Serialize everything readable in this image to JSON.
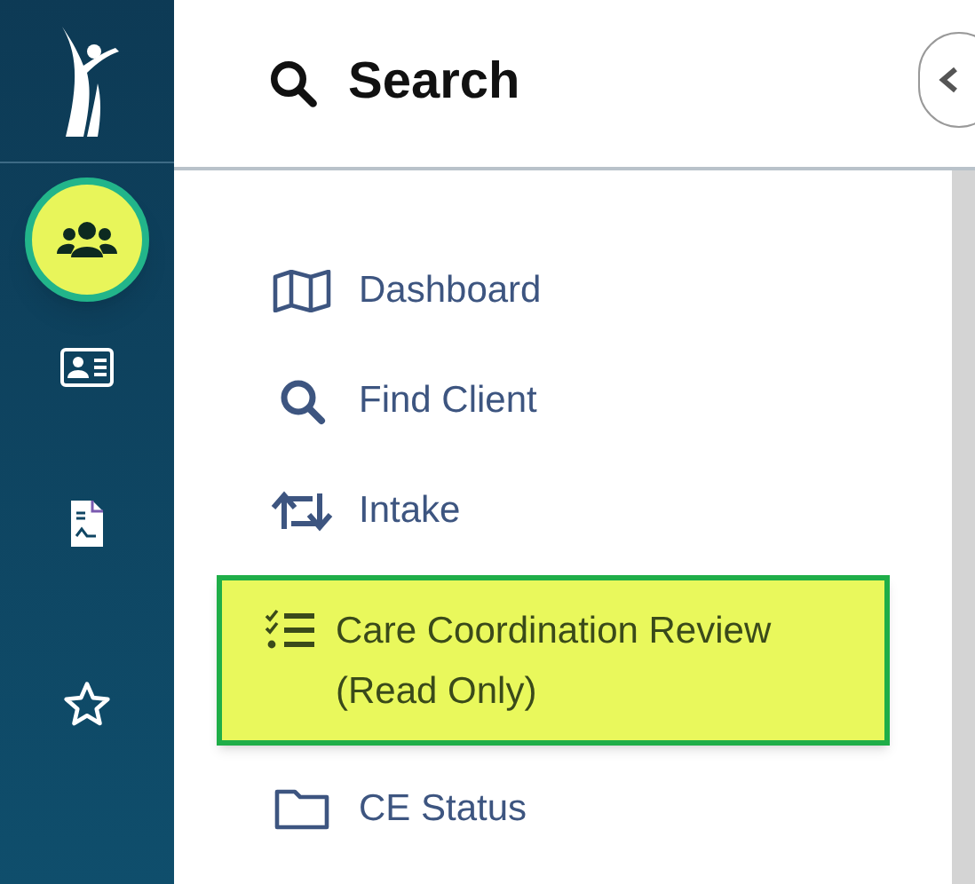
{
  "nav_rail": {
    "items": [
      {
        "selected": true
      },
      {
        "selected": false
      },
      {
        "selected": false
      },
      {
        "selected": false
      }
    ]
  },
  "panel": {
    "title": "Search",
    "items": [
      {
        "label": "Dashboard",
        "selected": false
      },
      {
        "label": "Find Client",
        "selected": false
      },
      {
        "label": "Intake",
        "selected": false
      },
      {
        "label": "Care Coordination Review (Read Only)",
        "selected": true
      },
      {
        "label": "CE Status",
        "selected": false
      }
    ]
  }
}
